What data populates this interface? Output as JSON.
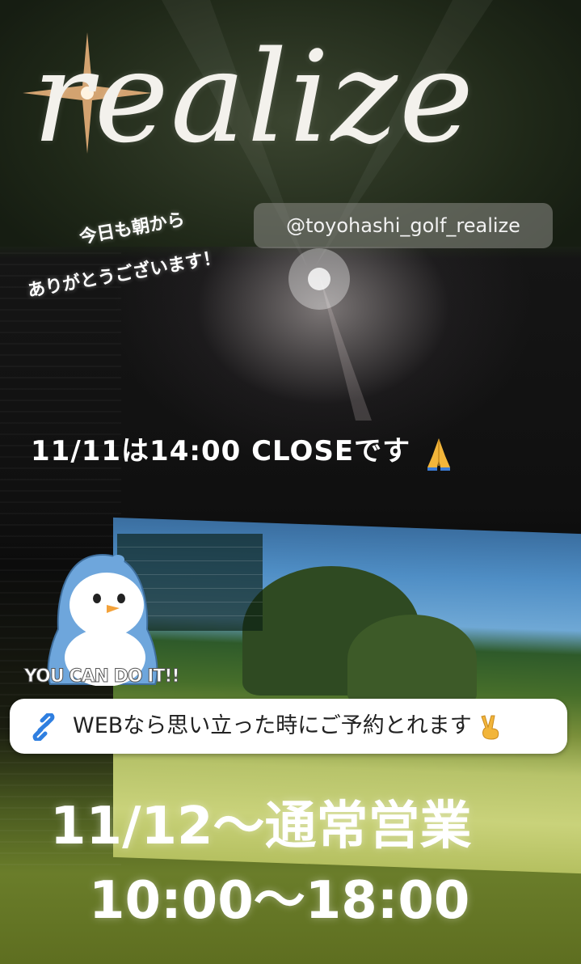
{
  "brand": {
    "logo_text": "realize",
    "handle": "@toyohashi_golf_realize"
  },
  "greeting": {
    "line1": "今日も朝から",
    "line2": "ありがとうございます！"
  },
  "notice": {
    "close_text": "11/11は14:00 CLOSEです",
    "close_icon": "folded-hands-icon"
  },
  "mascot": {
    "caption": "YOU CAN DO IT!!",
    "icon": "penguin-icon"
  },
  "web_link": {
    "label": "WEBなら思い立った時にご予約とれます",
    "icon": "link-icon",
    "trailing_icon": "victory-hand-icon"
  },
  "hours": {
    "line1": "11/12〜通常営業",
    "line2": "10:00〜18:00"
  },
  "colors": {
    "link_blue": "#2f7fe0",
    "text_white": "#ffffff",
    "pill_bg": "#ffffff"
  }
}
